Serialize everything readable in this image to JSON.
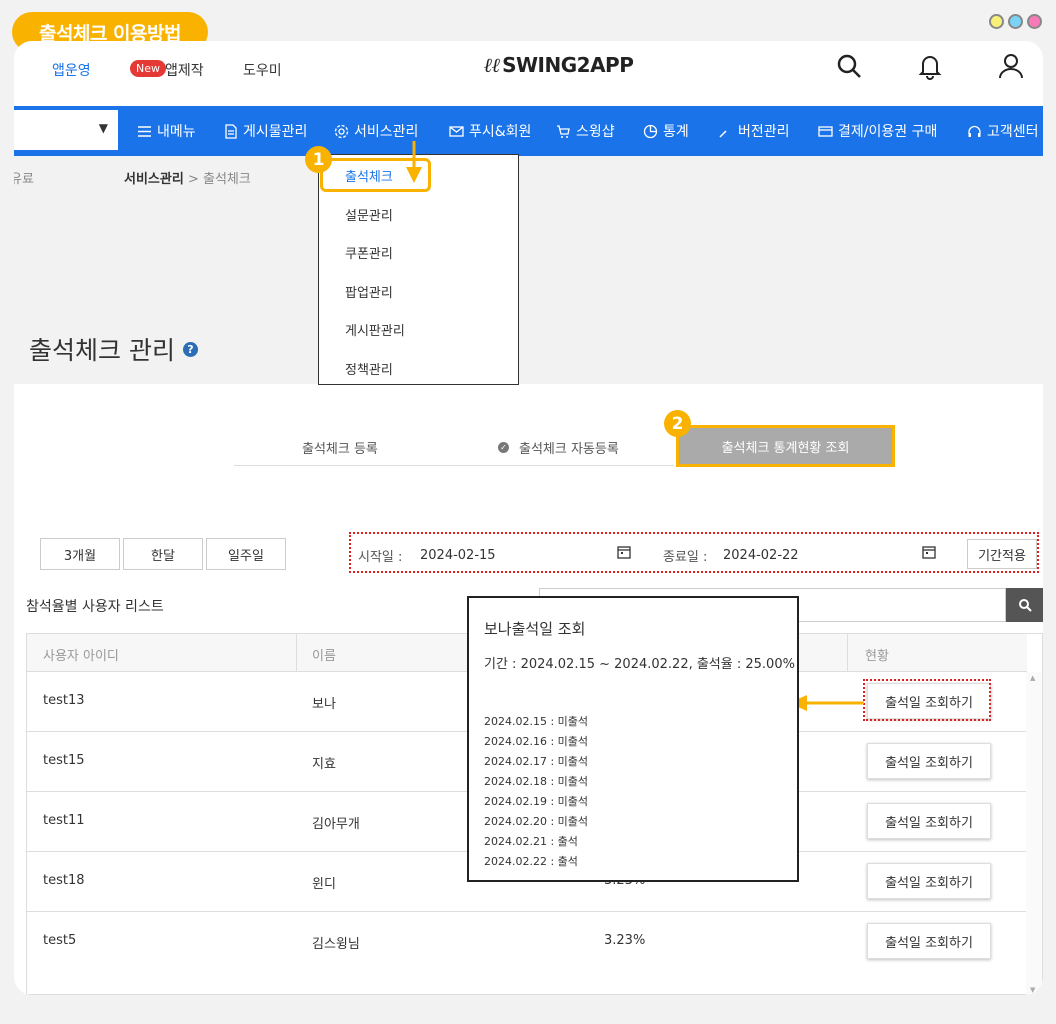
{
  "guide_label": "출석체크 이용방법",
  "header": {
    "nav": [
      "앱운영",
      "앱제작",
      "도우미"
    ],
    "new_badge": "New",
    "logo": "SWING2APP"
  },
  "menu": {
    "items": [
      "내메뉴",
      "게시물관리",
      "서비스관리",
      "푸시&회원",
      "스윙샵",
      "통계",
      "버전관리",
      "결제/이용권 구매",
      "고객센터"
    ]
  },
  "breadcrumb": {
    "left": "유료",
    "section": "서비스관리",
    "sep": ">",
    "current": "출석체크"
  },
  "dropdown": {
    "items": [
      "출석체크",
      "설문관리",
      "쿠폰관리",
      "팝업관리",
      "게시판관리",
      "정책관리"
    ]
  },
  "page_title": "출석체크 관리",
  "steps": [
    "1",
    "2"
  ],
  "tabs": {
    "register": "출석체크 등록",
    "auto": "출석체크 자동등록",
    "stats": "출석체크 통계현황 조회"
  },
  "period_buttons": [
    "3개월",
    "한달",
    "일주일"
  ],
  "date_filter": {
    "start_label": "시작일 :",
    "start_value": "2024-02-15",
    "end_label": "종료일 :",
    "end_value": "2024-02-22",
    "apply": "기간적용"
  },
  "list_title": "참석율별 사용자 리스트",
  "table": {
    "headers": [
      "사용자 아이디",
      "이름",
      "현황"
    ],
    "rows": [
      {
        "id": "test13",
        "name": "보나",
        "rate": "",
        "action": "출석일 조회하기"
      },
      {
        "id": "test15",
        "name": "지효",
        "rate": "",
        "action": "출석일 조회하기"
      },
      {
        "id": "test11",
        "name": "김아무개",
        "rate": "",
        "action": "출석일 조회하기"
      },
      {
        "id": "test18",
        "name": "윈디",
        "rate": "3.23%",
        "action": "출석일 조회하기"
      },
      {
        "id": "test5",
        "name": "김스윙님",
        "rate": "3.23%",
        "action": "출석일 조회하기"
      }
    ]
  },
  "popup": {
    "title": "보나출석일 조회",
    "summary": "기간 : 2024.02.15 ~ 2024.02.22, 출석율 : 25.00%",
    "entries": [
      "2024.02.15 : 미출석",
      "2024.02.16 : 미출석",
      "2024.02.17 : 미출석",
      "2024.02.18 : 미출석",
      "2024.02.19 : 미출석",
      "2024.02.20 : 미출석",
      "2024.02.21 : 출석",
      "2024.02.22 : 출석"
    ]
  },
  "colors": {
    "accent": "#f9b200",
    "menu_blue": "#1a73e8",
    "highlight_red": "#e02020"
  }
}
